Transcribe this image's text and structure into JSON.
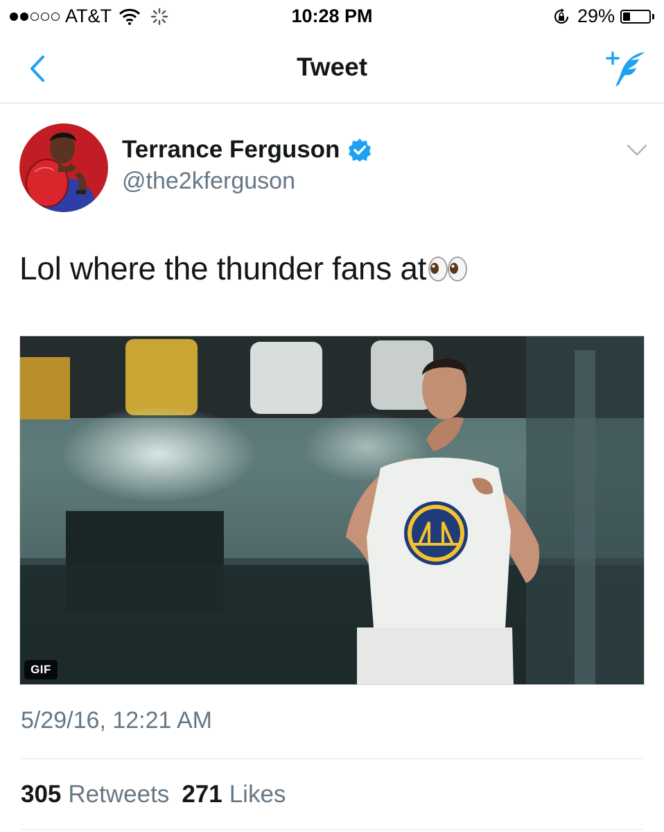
{
  "status_bar": {
    "signal_bars_filled": 2,
    "signal_bars_total": 5,
    "carrier": "AT&T",
    "time": "10:28 PM",
    "battery_percent": "29%",
    "battery_level": 0.29,
    "icons": [
      "wifi-icon",
      "activity-spinner-icon",
      "rotation-lock-icon",
      "battery-icon"
    ]
  },
  "nav": {
    "back_icon": "chevron-left-icon",
    "title": "Tweet",
    "compose_icon": "compose-tweet-icon"
  },
  "tweet": {
    "author_name": "Terrance Ferguson",
    "handle": "@the2kferguson",
    "verified": true,
    "text": "Lol where the thunder fans at",
    "emoji": "eyes-emoji",
    "media_badge": "GIF",
    "timestamp": "5/29/16, 12:21 AM",
    "retweets_count": "305",
    "retweets_label": "Retweets",
    "likes_count": "271",
    "likes_label": "Likes"
  },
  "colors": {
    "accent": "#1da1f2",
    "text_primary": "#14171a",
    "text_secondary": "#657786",
    "divider": "#e1e8ed"
  }
}
